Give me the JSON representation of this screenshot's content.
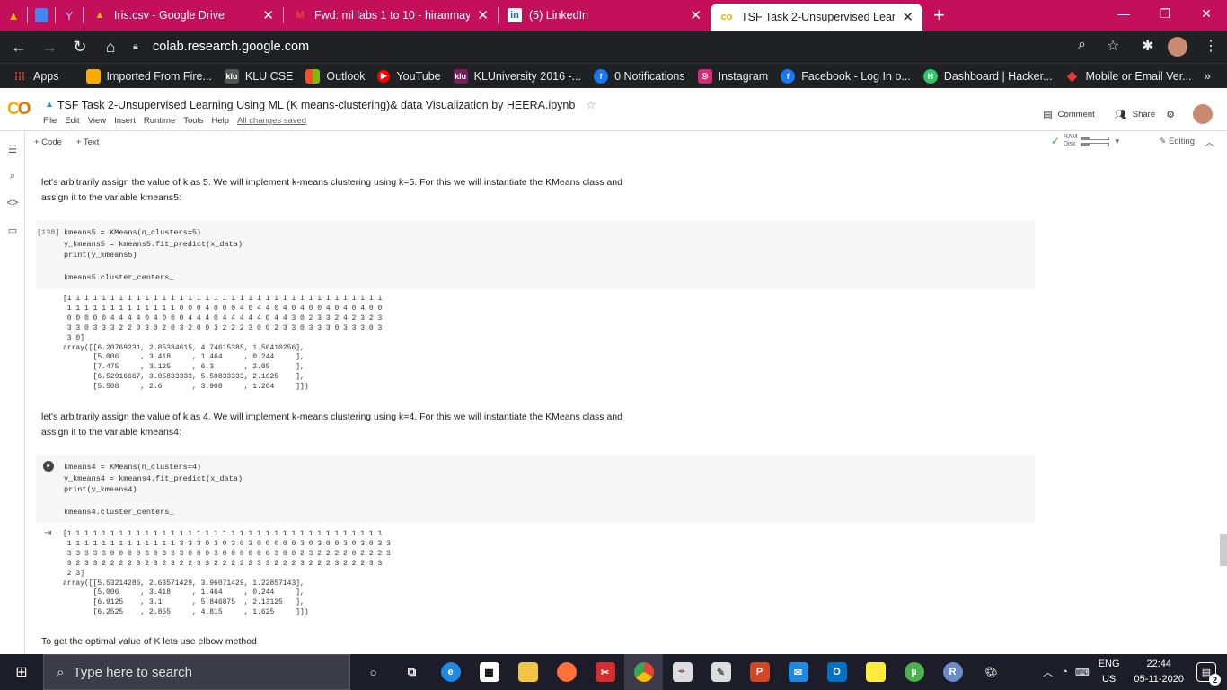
{
  "browser": {
    "tabs": [
      {
        "label": "Iris.csv - Google Drive",
        "icon": "google-drive-icon"
      },
      {
        "label": "Fwd: ml labs 1 to 10 - hiranmaye",
        "icon": "gmail-icon"
      },
      {
        "label": "(5) LinkedIn",
        "icon": "linkedin-icon"
      },
      {
        "label": "TSF Task 2-Unsupervised Learnin",
        "icon": "colab-icon"
      }
    ],
    "url": "colab.research.google.com",
    "bookmarks": [
      {
        "label": "Apps"
      },
      {
        "label": "Imported From Fire..."
      },
      {
        "label": "KLU CSE"
      },
      {
        "label": "Outlook"
      },
      {
        "label": "YouTube"
      },
      {
        "label": "KLUniversity 2016 -..."
      },
      {
        "label": "0 Notifications"
      },
      {
        "label": "Instagram"
      },
      {
        "label": "Facebook - Log In o..."
      },
      {
        "label": "Dashboard | Hacker..."
      },
      {
        "label": "Mobile or Email Ver..."
      }
    ]
  },
  "colab": {
    "title": "TSF Task 2-Unsupervised Learning Using ML (K means-clustering)& data Visualization by HEERA.ipynb",
    "menus": [
      "File",
      "Edit",
      "View",
      "Insert",
      "Runtime",
      "Tools",
      "Help"
    ],
    "saved": "All changes saved",
    "comment": "Comment",
    "share": "Share",
    "add_code": "+ Code",
    "add_text": "+ Text",
    "ram": "RAM",
    "disk": "Disk",
    "editing": "Editing"
  },
  "notebook": {
    "text1": "let's arbitrarily assign the value of k as 5. We will implement k-means clustering using k=5. For this we will instantiate the KMeans class and assign it to the variable kmeans5:",
    "cell1_num": "[138]",
    "cell1_code": "kmeans5 = KMeans(n_clusters=5)\ny_kmeans5 = kmeans5.fit_predict(x_data)\nprint(y_kmeans5)\n\nkmeans5.cluster_centers_",
    "out1": "[1 1 1 1 1 1 1 1 1 1 1 1 1 1 1 1 1 1 1 1 1 1 1 1 1 1 1 1 1 1 1 1 1 1 1 1 1\n 1 1 1 1 1 1 1 1 1 1 1 1 1 0 0 0 4 0 0 0 4 0 4 4 0 4 0 4 0 0 4 0 4 0 4 0 0\n 0 0 0 0 0 4 4 4 4 0 4 0 0 0 4 4 4 0 4 4 4 4 4 0 4 4 3 0 2 3 3 2 4 2 3 2 3\n 3 3 0 3 3 3 2 2 0 3 0 2 0 3 2 0 0 3 2 2 2 3 0 0 2 3 3 0 3 3 3 0 3 3 3 0 3\n 3 0]\narray([[6.20769231, 2.85384615, 4.74615385, 1.56410256],\n       [5.006     , 3.418     , 1.464     , 0.244     ],\n       [7.475     , 3.125     , 6.3       , 2.05      ],\n       [6.52916667, 3.05833333, 5.50833333, 2.1625    ],\n       [5.508     , 2.6       , 3.908     , 1.204     ]])",
    "text2": "let's arbitrarily assign the value of k as 4. We will implement k-means clustering using k=4. For this we will instantiate the KMeans class and assign it to the variable kmeans4:",
    "cell2_code": "kmeans4 = KMeans(n_clusters=4)\ny_kmeans4 = kmeans4.fit_predict(x_data)\nprint(y_kmeans4)\n\nkmeans4.cluster_centers_",
    "out2": "[1 1 1 1 1 1 1 1 1 1 1 1 1 1 1 1 1 1 1 1 1 1 1 1 1 1 1 1 1 1 1 1 1 1 1 1 1\n 1 1 1 1 1 1 1 1 1 1 1 1 1 3 3 3 0 3 0 3 0 3 0 0 0 0 0 3 0 3 0 0 3 0 3 0 3 3\n 3 3 3 3 3 0 0 0 0 3 0 3 3 3 0 0 0 3 0 0 0 0 0 0 3 0 0 2 3 2 2 2 2 0 2 2 2 3\n 3 2 3 3 2 2 2 2 3 2 3 2 3 2 2 3 3 2 2 2 2 2 3 3 2 2 2 3 2 2 2 3 2 2 2 3 3\n 2 3]\narray([[5.53214286, 2.63571429, 3.96071429, 1.22857143],\n       [5.006     , 3.418     , 1.464     , 0.244     ],\n       [6.9125    , 3.1       , 5.846875  , 2.13125   ],\n       [6.2525    , 2.855     , 4.815     , 1.625     ]])",
    "text3": "To get the optimal value of K lets use elbow method"
  },
  "taskbar": {
    "search_placeholder": "Type here to search",
    "lang_top": "ENG",
    "lang_bottom": "US",
    "time": "22:44",
    "date": "05-11-2020",
    "notif_count": "2"
  }
}
